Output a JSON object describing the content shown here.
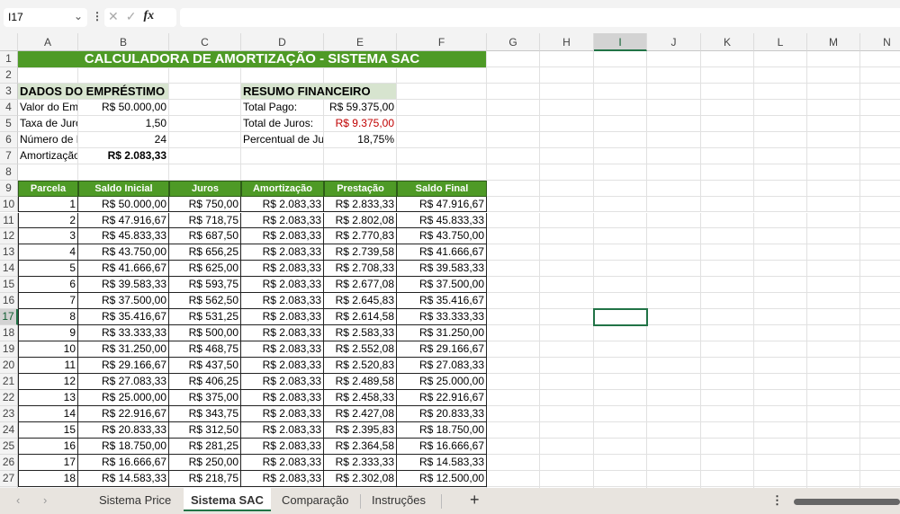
{
  "namebox": "I17",
  "formula_bar": {
    "cancel_icon": "✕",
    "enter_icon": "✓",
    "fx_label": "fx",
    "value": ""
  },
  "columns": [
    "A",
    "B",
    "C",
    "D",
    "E",
    "F",
    "G",
    "H",
    "I",
    "J",
    "K",
    "L",
    "M",
    "N"
  ],
  "selected_cell": "I17",
  "title": "CALCULADORA DE AMORTIZAÇÃO - SISTEMA SAC",
  "loan": {
    "heading": "DADOS DO EMPRÉSTIMO",
    "rows": [
      [
        "Valor do Empréstimo",
        "R$ 50.000,00"
      ],
      [
        "Taxa de Juros",
        "1,50"
      ],
      [
        "Número de Parcelas",
        "24"
      ],
      [
        "Amortização",
        "R$ 2.083,33"
      ]
    ]
  },
  "summary": {
    "heading": "RESUMO FINANCEIRO",
    "rows": [
      [
        "Total Pago:",
        "R$ 59.375,00"
      ],
      [
        "Total de Juros:",
        "R$ 9.375,00"
      ],
      [
        "Percentual de Juros",
        "18,75%"
      ]
    ]
  },
  "colors": {
    "green": "#4e9a26",
    "red": "#c00000"
  },
  "table": {
    "headers": [
      "Parcela",
      "Saldo Inicial",
      "Juros",
      "Amortização",
      "Prestação",
      "Saldo Final"
    ],
    "rows": [
      [
        "1",
        "R$ 50.000,00",
        "R$ 750,00",
        "R$ 2.083,33",
        "R$ 2.833,33",
        "R$ 47.916,67"
      ],
      [
        "2",
        "R$ 47.916,67",
        "R$ 718,75",
        "R$ 2.083,33",
        "R$ 2.802,08",
        "R$ 45.833,33"
      ],
      [
        "3",
        "R$ 45.833,33",
        "R$ 687,50",
        "R$ 2.083,33",
        "R$ 2.770,83",
        "R$ 43.750,00"
      ],
      [
        "4",
        "R$ 43.750,00",
        "R$ 656,25",
        "R$ 2.083,33",
        "R$ 2.739,58",
        "R$ 41.666,67"
      ],
      [
        "5",
        "R$ 41.666,67",
        "R$ 625,00",
        "R$ 2.083,33",
        "R$ 2.708,33",
        "R$ 39.583,33"
      ],
      [
        "6",
        "R$ 39.583,33",
        "R$ 593,75",
        "R$ 2.083,33",
        "R$ 2.677,08",
        "R$ 37.500,00"
      ],
      [
        "7",
        "R$ 37.500,00",
        "R$ 562,50",
        "R$ 2.083,33",
        "R$ 2.645,83",
        "R$ 35.416,67"
      ],
      [
        "8",
        "R$ 35.416,67",
        "R$ 531,25",
        "R$ 2.083,33",
        "R$ 2.614,58",
        "R$ 33.333,33"
      ],
      [
        "9",
        "R$ 33.333,33",
        "R$ 500,00",
        "R$ 2.083,33",
        "R$ 2.583,33",
        "R$ 31.250,00"
      ],
      [
        "10",
        "R$ 31.250,00",
        "R$ 468,75",
        "R$ 2.083,33",
        "R$ 2.552,08",
        "R$ 29.166,67"
      ],
      [
        "11",
        "R$ 29.166,67",
        "R$ 437,50",
        "R$ 2.083,33",
        "R$ 2.520,83",
        "R$ 27.083,33"
      ],
      [
        "12",
        "R$ 27.083,33",
        "R$ 406,25",
        "R$ 2.083,33",
        "R$ 2.489,58",
        "R$ 25.000,00"
      ],
      [
        "13",
        "R$ 25.000,00",
        "R$ 375,00",
        "R$ 2.083,33",
        "R$ 2.458,33",
        "R$ 22.916,67"
      ],
      [
        "14",
        "R$ 22.916,67",
        "R$ 343,75",
        "R$ 2.083,33",
        "R$ 2.427,08",
        "R$ 20.833,33"
      ],
      [
        "15",
        "R$ 20.833,33",
        "R$ 312,50",
        "R$ 2.083,33",
        "R$ 2.395,83",
        "R$ 18.750,00"
      ],
      [
        "16",
        "R$ 18.750,00",
        "R$ 281,25",
        "R$ 2.083,33",
        "R$ 2.364,58",
        "R$ 16.666,67"
      ],
      [
        "17",
        "R$ 16.666,67",
        "R$ 250,00",
        "R$ 2.083,33",
        "R$ 2.333,33",
        "R$ 14.583,33"
      ],
      [
        "18",
        "R$ 14.583,33",
        "R$ 218,75",
        "R$ 2.083,33",
        "R$ 2.302,08",
        "R$ 12.500,00"
      ]
    ]
  },
  "tabs": [
    {
      "label": "Sistema Price",
      "active": false
    },
    {
      "label": "Sistema SAC",
      "active": true
    },
    {
      "label": "Comparação",
      "active": false
    },
    {
      "label": "Instruções",
      "active": false
    }
  ],
  "add_sheet": "+",
  "nav_prev": "‹",
  "nav_next": "›"
}
